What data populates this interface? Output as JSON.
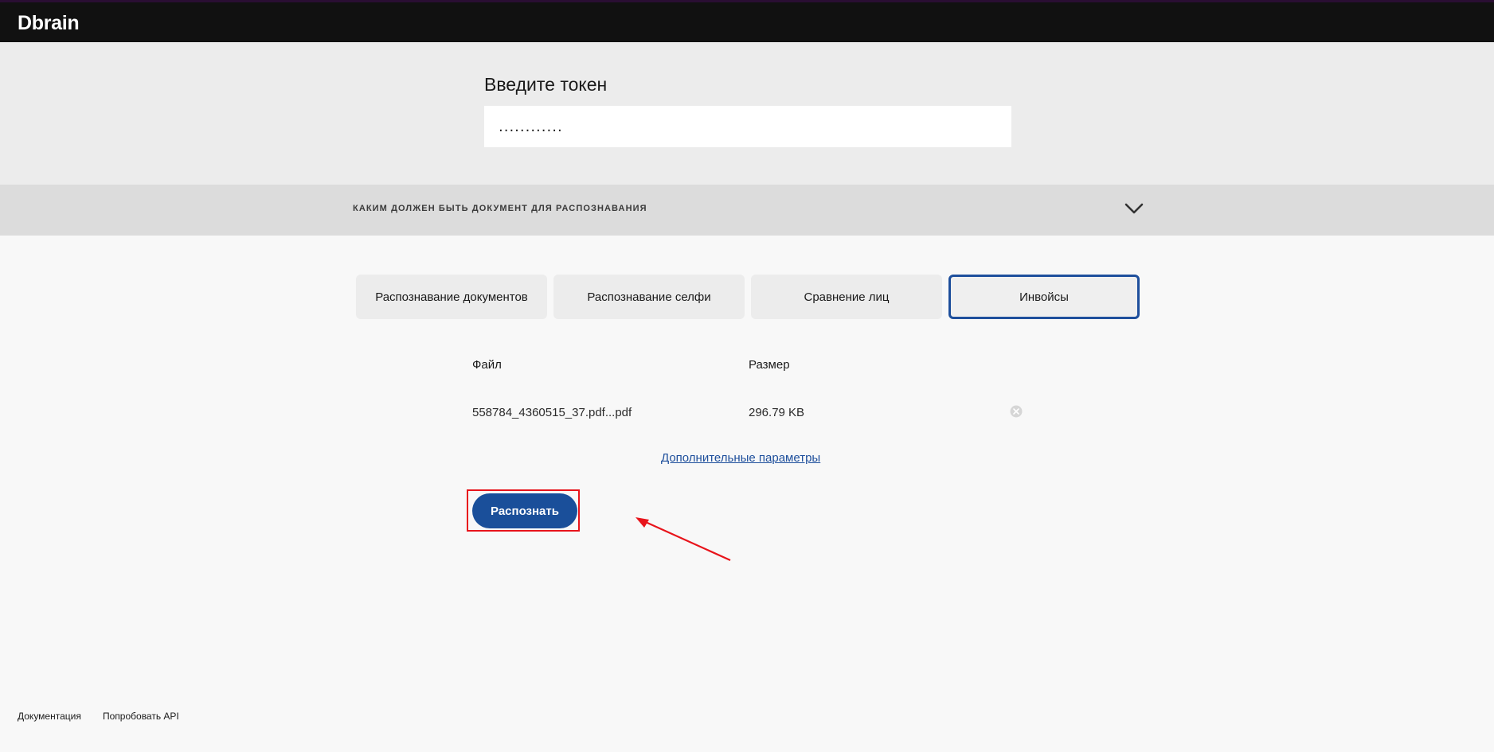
{
  "header": {
    "logo": "Dbrain"
  },
  "token": {
    "title": "Введите токен",
    "value": "............"
  },
  "accordion": {
    "label": "КАКИМ ДОЛЖЕН БЫТЬ ДОКУМЕНТ ДЛЯ РАСПОЗНАВАНИЯ",
    "icon": "chevron-down-icon"
  },
  "tabs": [
    {
      "label": "Распознавание документов",
      "active": false
    },
    {
      "label": "Распознавание селфи",
      "active": false
    },
    {
      "label": "Сравнение лиц",
      "active": false
    },
    {
      "label": "Инвойсы",
      "active": true
    }
  ],
  "files": {
    "columns": {
      "file": "Файл",
      "size": "Размер"
    },
    "rows": [
      {
        "name": "558784_4360515_37.pdf...pdf",
        "size": "296.79 KB"
      }
    ]
  },
  "extra_params_link": "Дополнительные параметры",
  "recognize_button": "Распознать",
  "annotation": {
    "color": "#e8141b"
  },
  "colors": {
    "accent": "#1a4f9a",
    "active_tab_border": "#1e4f9c",
    "topbar": "#111111"
  },
  "footer": {
    "links": [
      "Документация",
      "Попробовать API"
    ]
  }
}
